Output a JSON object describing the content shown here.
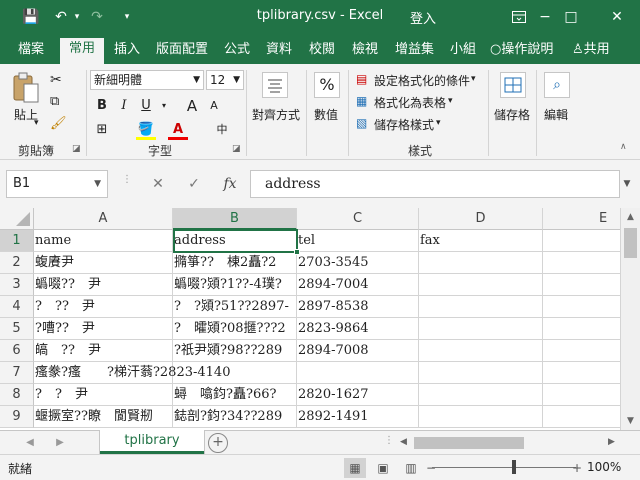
{
  "window": {
    "title": "tplibrary.csv  -  Excel",
    "login": "登入",
    "minimize": "−",
    "maximize": "□",
    "close": "✕"
  },
  "quick_access": {
    "save": "💾",
    "undo": "↶",
    "undo_drop": "▾",
    "redo": "↷",
    "customize": "▾"
  },
  "ribbon_tabs": [
    "檔案",
    "常用",
    "插入",
    "版面配置",
    "公式",
    "資料",
    "校閱",
    "檢視",
    "增益集",
    "小組",
    "操作說明",
    "共用"
  ],
  "ribbon_tab_active": "常用",
  "ribbon": {
    "clipboard": {
      "label": "剪貼簿",
      "paste": "貼上"
    },
    "font": {
      "label": "字型",
      "name": "新細明體",
      "size": "12",
      "bold": "B",
      "italic": "I",
      "underline": "U",
      "grow": "A",
      "shrink": "A"
    },
    "alignment": {
      "label": "對齊方式"
    },
    "number": {
      "label": "數值",
      "symbol": "%"
    },
    "styles": {
      "label": "樣式",
      "conditional": "設定格式化的條件",
      "table": "格式化為表格",
      "cell": "儲存格樣式"
    },
    "cells": {
      "label": "儲存格"
    },
    "editing": {
      "label": "編輯"
    }
  },
  "formula_bar": {
    "name_box": "B1",
    "cancel": "✕",
    "enter": "✓",
    "fx": "fx",
    "value": "address"
  },
  "grid": {
    "columns": [
      "A",
      "B",
      "C",
      "D",
      "E"
    ],
    "selected_column": "B",
    "selected_row": "1",
    "rows": [
      {
        "num": "1",
        "cells": [
          "name",
          "address",
          "tel",
          "fax"
        ]
      },
      {
        "num": "2",
        "cells": [
          "蝮賡尹",
          "撱箏??　棟2矗?2",
          "2703-3545",
          ""
        ]
      },
      {
        "num": "3",
        "cells": [
          "蟡啜??　尹",
          "蟡啜?熲?1??-4璞?",
          "2894-7004",
          ""
        ]
      },
      {
        "num": "4",
        "cells": [
          "?　??　尹",
          "?　?熲?51??2897-",
          "2897-8538",
          ""
        ]
      },
      {
        "num": "5",
        "cells": [
          "?嘈??　尹",
          "?　曤熲?08擓???2",
          "2823-9864",
          ""
        ]
      },
      {
        "num": "6",
        "cells": [
          "皜　??　尹",
          "?祇尹熲?98??289",
          "2894-7008",
          ""
        ]
      },
      {
        "num": "7",
        "cells": [
          "瘙豢?瘙　　?梯汗蓊?2823-4140",
          "",
          "",
          ""
        ]
      },
      {
        "num": "8",
        "cells": [
          "?　?　尹",
          "蟳　噏鈞?矗?66?",
          "2820-1627",
          ""
        ]
      },
      {
        "num": "9",
        "cells": [
          "蝘撅室??瞭　閬賢剏",
          "鋕剖?鈞?34??289",
          "2892-1491",
          ""
        ]
      }
    ]
  },
  "sheet_tabs": [
    "tplibrary"
  ],
  "status": {
    "text": "就緒",
    "zoom": "100%",
    "zoom_minus": "−",
    "zoom_plus": "+"
  }
}
